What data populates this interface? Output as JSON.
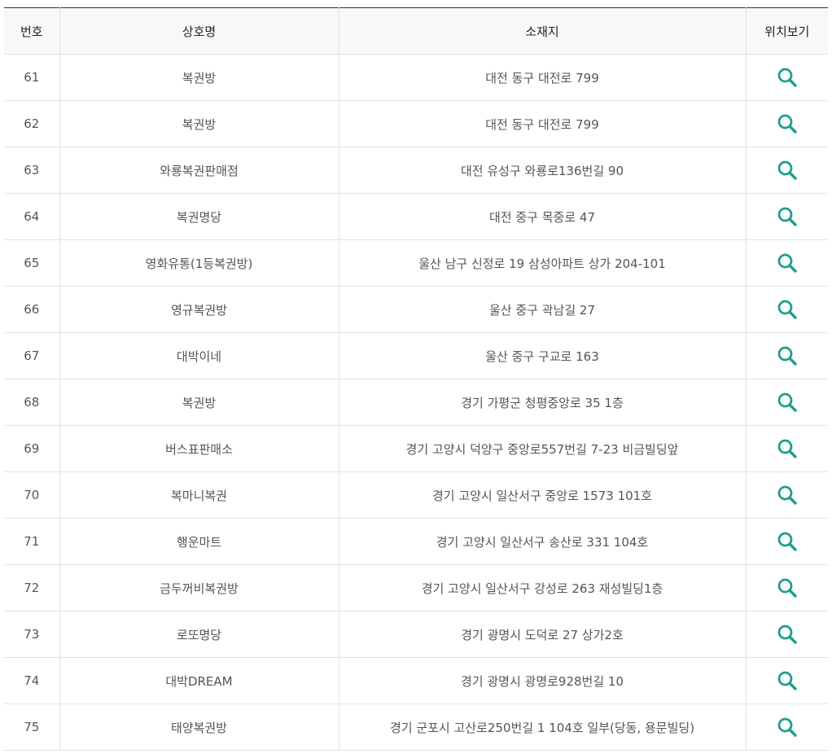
{
  "table": {
    "headers": {
      "num": "번호",
      "name": "상호명",
      "address": "소재지",
      "view": "위치보기"
    },
    "rows": [
      {
        "num": "61",
        "name": "복권방",
        "address": "대전 동구 대전로 799"
      },
      {
        "num": "62",
        "name": "복권방",
        "address": "대전 동구 대전로 799"
      },
      {
        "num": "63",
        "name": "와룡복권판매점",
        "address": "대전 유성구 와룡로136번길 90"
      },
      {
        "num": "64",
        "name": "복권명당",
        "address": "대전 중구 목중로 47"
      },
      {
        "num": "65",
        "name": "영화유통(1등복권방)",
        "address": "울산 남구 신정로 19 삼성아파트 상가 204-101"
      },
      {
        "num": "66",
        "name": "영규복권방",
        "address": "울산 중구 곽남길 27"
      },
      {
        "num": "67",
        "name": "대박이네",
        "address": "울산 중구 구교로 163"
      },
      {
        "num": "68",
        "name": "복권방",
        "address": "경기 가평군 청평중앙로 35 1층"
      },
      {
        "num": "69",
        "name": "버스표판매소",
        "address": "경기 고양시 덕양구 중앙로557번길 7-23 비금빌딩앞"
      },
      {
        "num": "70",
        "name": "복마니복권",
        "address": "경기 고양시 일산서구 중앙로 1573 101호"
      },
      {
        "num": "71",
        "name": "행운마트",
        "address": "경기 고양시 일산서구 송산로 331 104호"
      },
      {
        "num": "72",
        "name": "금두꺼비복권방",
        "address": "경기 고양시 일산서구 강성로 263 재성빌딩1층"
      },
      {
        "num": "73",
        "name": "로또명당",
        "address": "경기 광명시 도덕로 27 상가2호"
      },
      {
        "num": "74",
        "name": "대박DREAM",
        "address": "경기 광명시 광명로928번길 10"
      },
      {
        "num": "75",
        "name": "태양복권방",
        "address": "경기 군포시 고산로250번길 1 104호 일부(당동, 용문빌딩)"
      }
    ]
  },
  "icons": {
    "view": "search-icon"
  },
  "colors": {
    "accent": "#1f9e8e",
    "header_bg": "#f8f8f8",
    "border": "#e3e3e3",
    "top_border": "#333333"
  }
}
